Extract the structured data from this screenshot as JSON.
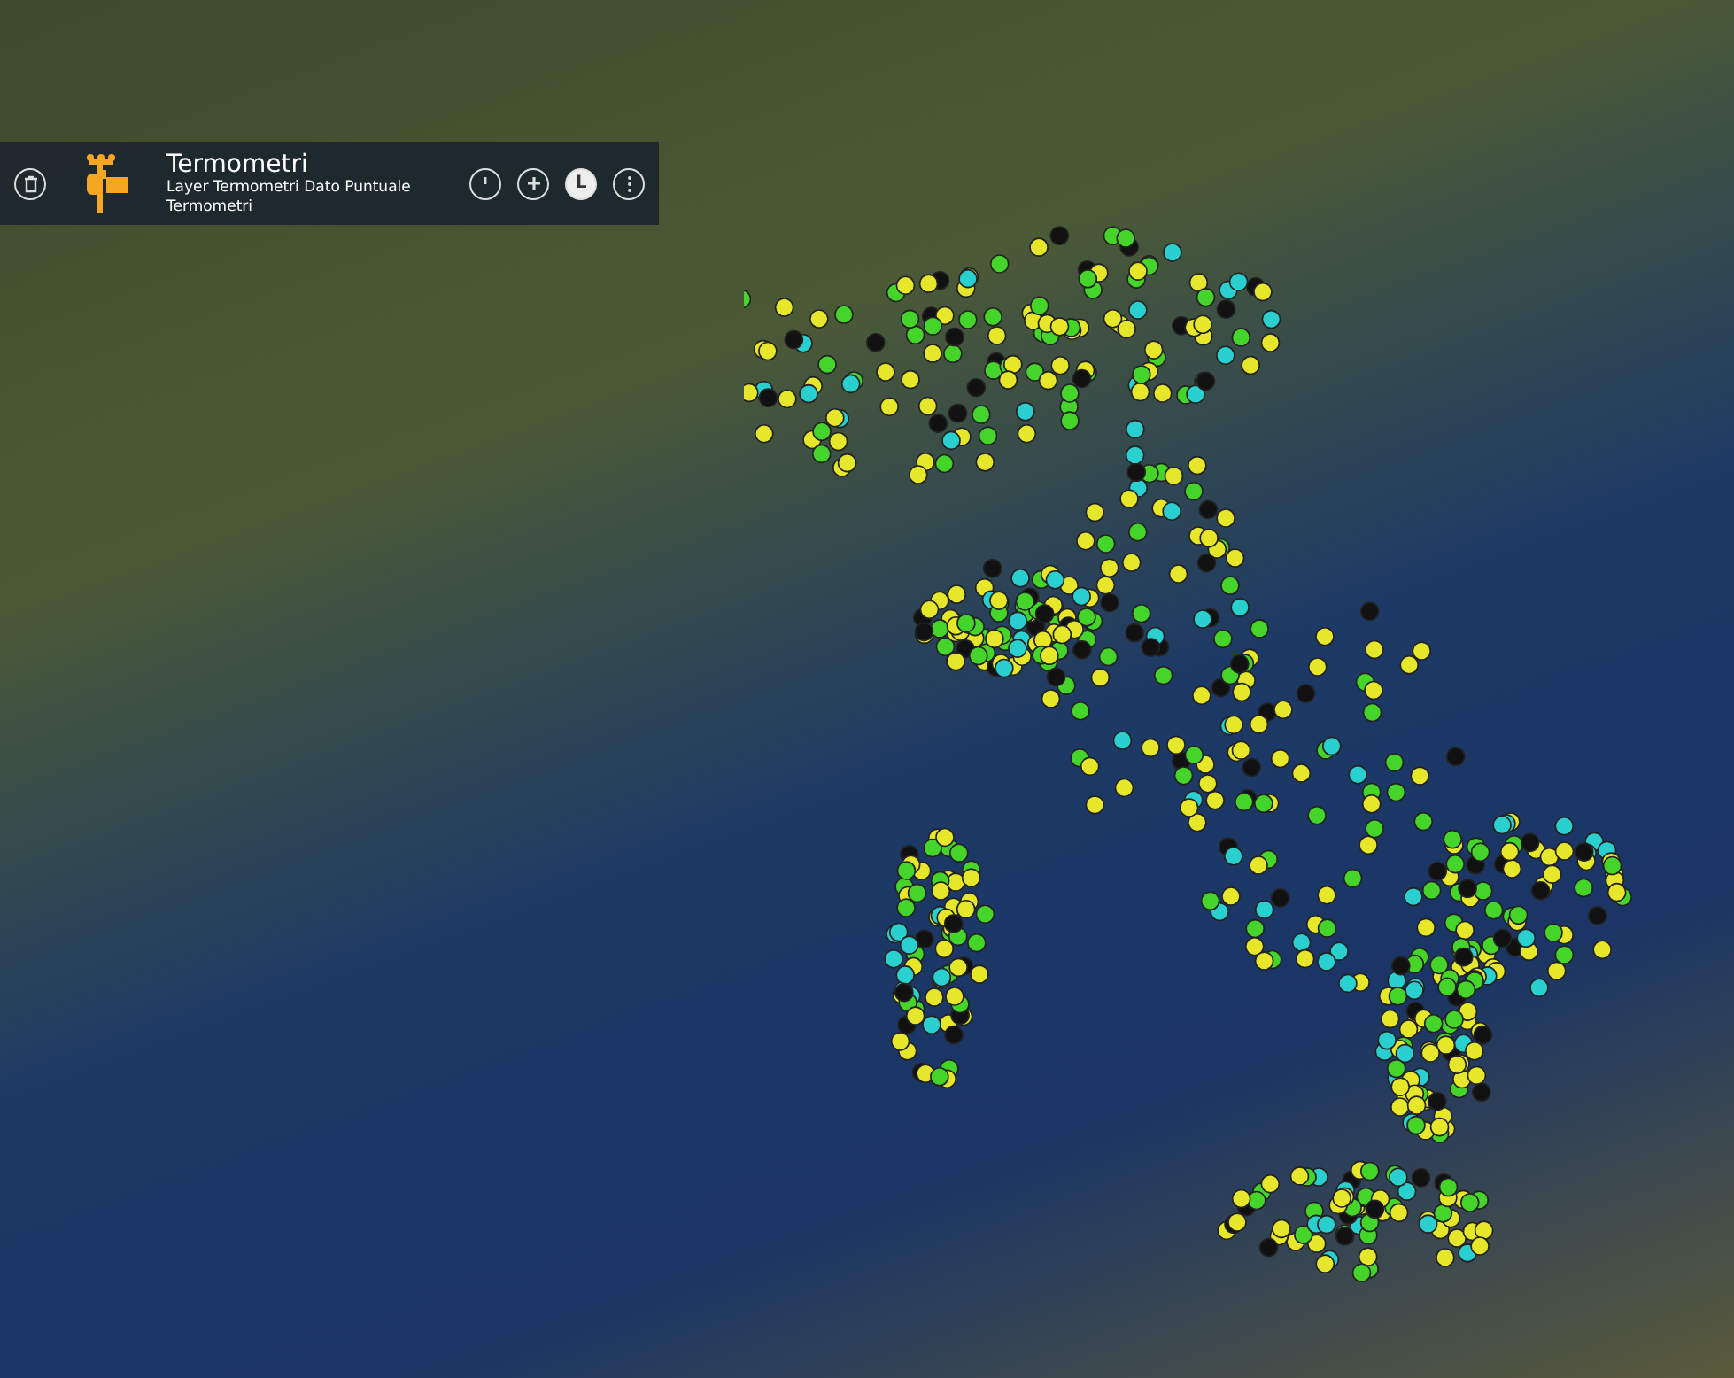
{
  "layer_panel": {
    "title": "Termometri",
    "subtitle": "Layer Termometri Dato Puntuale Termometri",
    "legend_button": {
      "label": "L",
      "selected": true
    }
  }
}
